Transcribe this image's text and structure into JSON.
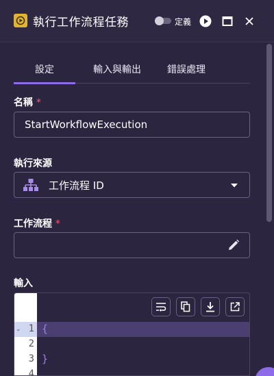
{
  "header": {
    "title": "執行工作流程任務",
    "toggle_label": "定義",
    "buttons": [
      "run-icon",
      "maximize-icon",
      "close-icon"
    ]
  },
  "tabs": [
    {
      "label": "設定",
      "active": true
    },
    {
      "label": "輸入與輸出",
      "active": false
    },
    {
      "label": "錯誤處理",
      "active": false
    }
  ],
  "form": {
    "name_label": "名稱",
    "required_mark": "*",
    "name_value": "StartWorkflowExecution",
    "source_label": "執行來源",
    "source_value": "工作流程 ID",
    "workflow_label": "工作流程",
    "workflow_value": "",
    "input_label": "輸入"
  },
  "editor": {
    "line_numbers": [
      "1",
      "2",
      "3",
      "4"
    ],
    "lines": [
      "{",
      "",
      "}",
      ""
    ],
    "tools": [
      "wrap-icon",
      "copy-icon",
      "download-icon",
      "open-external-icon"
    ]
  },
  "colors": {
    "accent": "#8e6be8",
    "background": "#2c2540",
    "app_icon": "#e0b431",
    "required": "#e0607a"
  }
}
